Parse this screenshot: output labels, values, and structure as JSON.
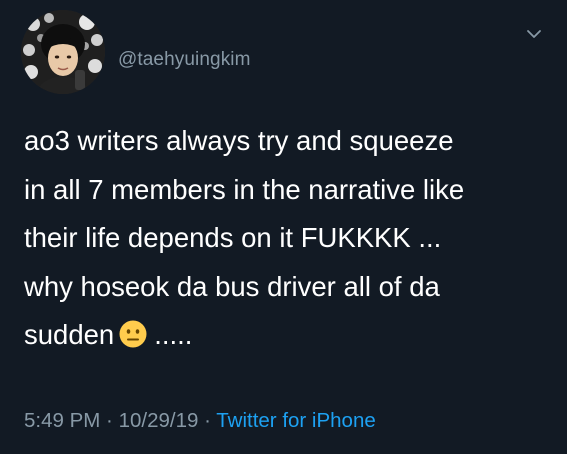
{
  "tweet": {
    "handle": "@taehyuingkim",
    "lines": [
      "ao3 writers always try and squeeze",
      "in all 7 members in the narrative like",
      "their life depends on it FUKKKK ...",
      "why hoseok da bus driver all of da",
      "sudden"
    ],
    "emoji_icon": "neutral-face-emoji",
    "trailing_text": ".....",
    "time": "5:49 PM",
    "date": "10/29/19",
    "separator": " · ",
    "source": "Twitter for iPhone"
  },
  "icons": {
    "menu": "chevron-down-icon"
  },
  "colors": {
    "background": "#121a24",
    "text": "#ffffff",
    "muted": "#8899a6",
    "link": "#1da1f2",
    "emoji": "#ffcc4d"
  }
}
